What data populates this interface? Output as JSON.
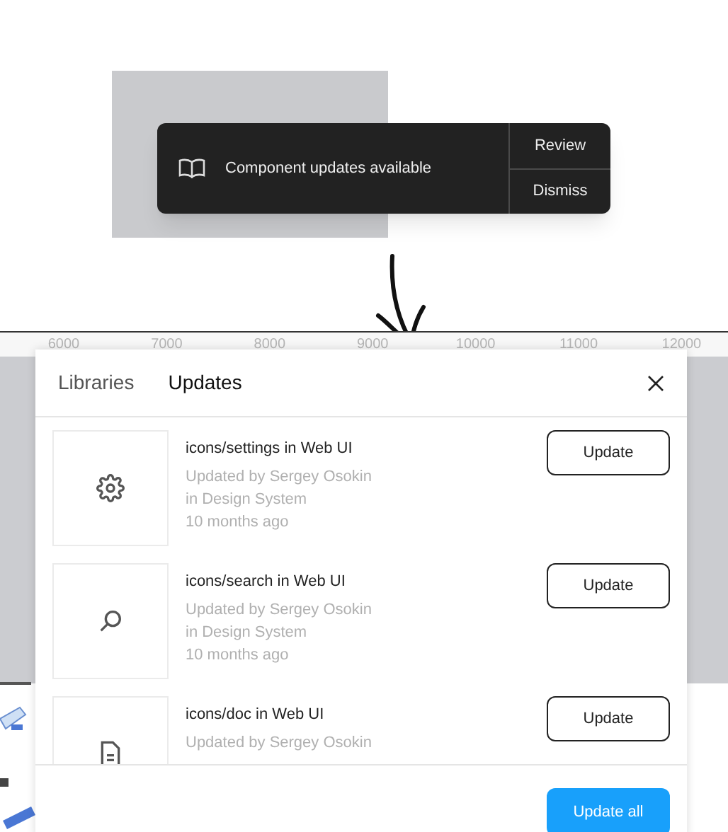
{
  "toast": {
    "message": "Component updates available",
    "actions": [
      "Review",
      "Dismiss"
    ]
  },
  "ruler": {
    "ticks": [
      "6000",
      "7000",
      "8000",
      "9000",
      "10000",
      "11000",
      "12000"
    ]
  },
  "panel": {
    "tabs": [
      {
        "label": "Libraries",
        "selected": false
      },
      {
        "label": "Updates",
        "selected": true
      }
    ],
    "updates": [
      {
        "kind": "gear",
        "title": "icons/settings in Web UI",
        "details": [
          "Updated by Sergey Osokin",
          "in Design System",
          "10 months ago"
        ],
        "action": "Update"
      },
      {
        "kind": "search",
        "title": "icons/search in Web UI",
        "details": [
          "Updated by Sergey Osokin",
          "in Design System",
          "10 months ago"
        ],
        "action": "Update"
      },
      {
        "kind": "doc",
        "title": "icons/doc in Web UI",
        "details": [
          "Updated by Sergey Osokin"
        ],
        "action": "Update"
      }
    ],
    "footer_button": "Update all"
  }
}
